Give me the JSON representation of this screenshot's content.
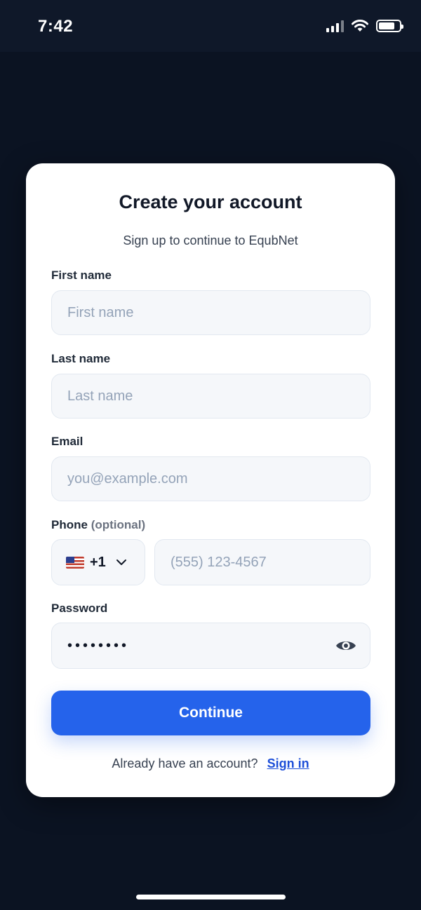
{
  "status_bar": {
    "time": "7:42",
    "icons": [
      "signal-icon",
      "wifi-icon",
      "battery-icon"
    ]
  },
  "card": {
    "title": "Create your account",
    "subtitle": "Sign up to continue to EqubNet"
  },
  "form": {
    "first_name": {
      "label": "First name",
      "placeholder": "First name"
    },
    "last_name": {
      "label": "Last name",
      "placeholder": "Last name"
    },
    "email": {
      "label": "Email",
      "placeholder": "you@example.com"
    },
    "phone": {
      "label": "Phone",
      "label_suffix": "(optional)",
      "country_flag": "us-flag-icon",
      "country_code": "+1",
      "placeholder": "(555) 123-4567"
    },
    "password": {
      "label": "Password",
      "value": "••••••••",
      "toggle_icon": "eye-icon"
    },
    "continue_label": "Continue"
  },
  "footer": {
    "prompt": "Already have an account?",
    "signin_label": "Sign in"
  },
  "colors": {
    "background": "#0b1322",
    "primary": "#2563eb",
    "link": "#1d4ed8",
    "input_bg": "#f5f7fa"
  }
}
